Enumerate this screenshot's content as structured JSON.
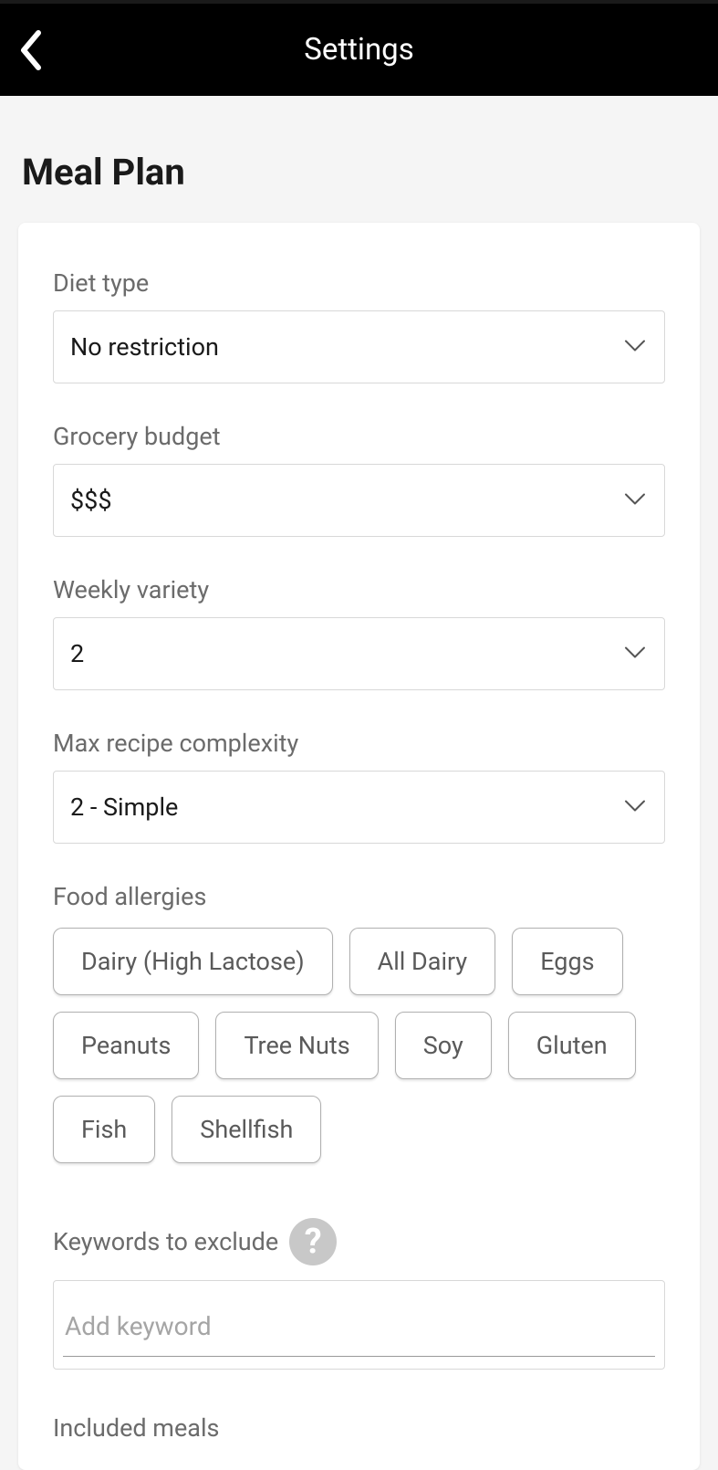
{
  "header": {
    "title": "Settings"
  },
  "page": {
    "title": "Meal Plan"
  },
  "fields": {
    "diet_type": {
      "label": "Diet type",
      "value": "No restriction"
    },
    "grocery_budget": {
      "label": "Grocery budget",
      "value": "$$$"
    },
    "weekly_variety": {
      "label": "Weekly variety",
      "value": "2"
    },
    "max_complexity": {
      "label": "Max recipe complexity",
      "value": "2 - Simple"
    },
    "food_allergies": {
      "label": "Food allergies",
      "options": [
        "Dairy (High Lactose)",
        "All Dairy",
        "Eggs",
        "Peanuts",
        "Tree Nuts",
        "Soy",
        "Gluten",
        "Fish",
        "Shellfish"
      ]
    },
    "keywords_exclude": {
      "label": "Keywords to exclude",
      "placeholder": "Add keyword"
    },
    "included_meals": {
      "label": "Included meals"
    }
  }
}
